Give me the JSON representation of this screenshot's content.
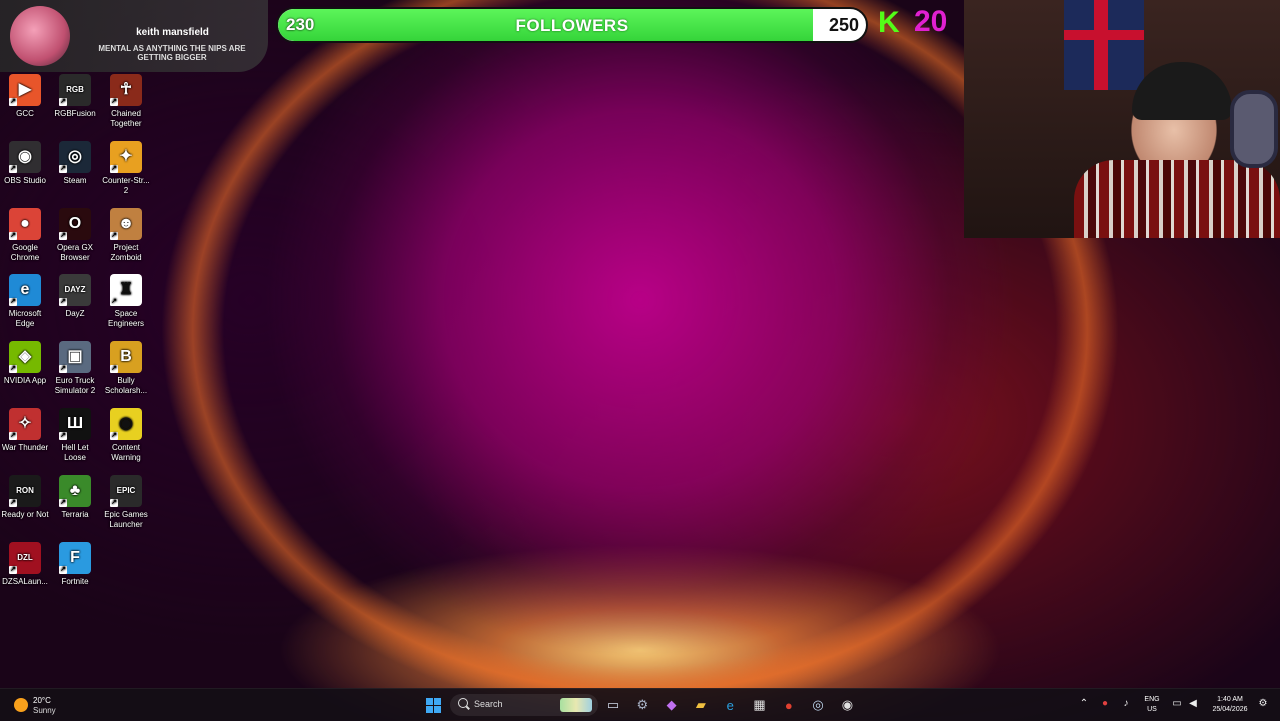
{
  "notification": {
    "name": "keith mansfield",
    "message": "MENTAL AS ANYTHING THE NIPS ARE GETTING BIGGER"
  },
  "followers": {
    "start": "230",
    "label": "FOLLOWERS",
    "goal": "250",
    "progress": 0.91
  },
  "kick": {
    "logo": "K",
    "count": "20"
  },
  "desktop_icons": [
    {
      "label": "GCC",
      "icon": "gcc-icon",
      "glyph": "▶",
      "color": "#e8552a"
    },
    {
      "label": "RGBFusion",
      "icon": "rgbfusion-icon",
      "glyph": "RGB",
      "color": "#2a2a2a"
    },
    {
      "label": "Chained Together",
      "icon": "chained-together-icon",
      "glyph": "☥",
      "color": "#8a2a1a"
    },
    {
      "label": "OBS Studio",
      "icon": "obs-studio-icon",
      "glyph": "◉",
      "color": "#302e31"
    },
    {
      "label": "Steam",
      "icon": "steam-icon",
      "glyph": "◎",
      "color": "#1b2838"
    },
    {
      "label": "Counter-Str... 2",
      "icon": "counter-strike-icon",
      "glyph": "✦",
      "color": "#e8a020"
    },
    {
      "label": "Google Chrome",
      "icon": "chrome-icon",
      "glyph": "●",
      "color": "#db4437"
    },
    {
      "label": "Opera GX Browser",
      "icon": "opera-gx-icon",
      "glyph": "O",
      "color": "#2a0a0e"
    },
    {
      "label": "Project Zomboid",
      "icon": "project-zomboid-icon",
      "glyph": "☻",
      "color": "#c08040"
    },
    {
      "label": "Microsoft Edge",
      "icon": "edge-icon",
      "glyph": "e",
      "color": "#1f8ad6"
    },
    {
      "label": "DayZ",
      "icon": "dayz-icon",
      "glyph": "DAYZ",
      "color": "#3a3a3a"
    },
    {
      "label": "Space Engineers",
      "icon": "space-engineers-icon",
      "glyph": "♜",
      "color": "#ffffff"
    },
    {
      "label": "NVIDIA App",
      "icon": "nvidia-icon",
      "glyph": "◈",
      "color": "#76b900"
    },
    {
      "label": "Euro Truck Simulator 2",
      "icon": "euro-truck-icon",
      "glyph": "▣",
      "color": "#5a6a80"
    },
    {
      "label": "Bully Scholarsh...",
      "icon": "bully-icon",
      "glyph": "B",
      "color": "#d8a020"
    },
    {
      "label": "War Thunder",
      "icon": "war-thunder-icon",
      "glyph": "✧",
      "color": "#c03030"
    },
    {
      "label": "Hell Let Loose",
      "icon": "hell-let-loose-icon",
      "glyph": "Ш",
      "color": "#111111"
    },
    {
      "label": "Content Warning",
      "icon": "content-warning-icon",
      "glyph": "◉",
      "color": "#e8d020"
    },
    {
      "label": "Ready or Not",
      "icon": "ready-or-not-icon",
      "glyph": "RON",
      "color": "#1a1a1a"
    },
    {
      "label": "Terraria",
      "icon": "terraria-icon",
      "glyph": "♣",
      "color": "#3a8a2a"
    },
    {
      "label": "Epic Games Launcher",
      "icon": "epic-games-icon",
      "glyph": "EPIC",
      "color": "#2a2a2a"
    },
    {
      "label": "DZSALaun...",
      "icon": "dzsa-launcher-icon",
      "glyph": "DZL",
      "color": "#a01020"
    },
    {
      "label": "Fortnite",
      "icon": "fortnite-icon",
      "glyph": "F",
      "color": "#2a9ae0"
    }
  ],
  "taskbar": {
    "weather_temp": "20°C",
    "weather_condition": "Sunny",
    "search_label": "Search",
    "pinned": [
      {
        "name": "task-view-icon",
        "glyph": "▭",
        "color": "#cfd8e8"
      },
      {
        "name": "settings-icon",
        "glyph": "⚙",
        "color": "#aab4c8"
      },
      {
        "name": "copilot-icon",
        "glyph": "◆",
        "color": "#c070f0"
      },
      {
        "name": "file-explorer-icon",
        "glyph": "▰",
        "color": "#f0c040"
      },
      {
        "name": "edge-taskbar-icon",
        "glyph": "e",
        "color": "#2aa0e0"
      },
      {
        "name": "store-icon",
        "glyph": "▦",
        "color": "#e0e0e0"
      },
      {
        "name": "chrome-taskbar-icon",
        "glyph": "●",
        "color": "#e04030"
      },
      {
        "name": "steam-taskbar-icon",
        "glyph": "◎",
        "color": "#c0d8f0"
      },
      {
        "name": "obs-taskbar-icon",
        "glyph": "◉",
        "color": "#e0e0e0"
      }
    ],
    "lang_top": "ENG",
    "lang_bottom": "US",
    "time": "1:40 AM",
    "date": "25/04/2026"
  }
}
